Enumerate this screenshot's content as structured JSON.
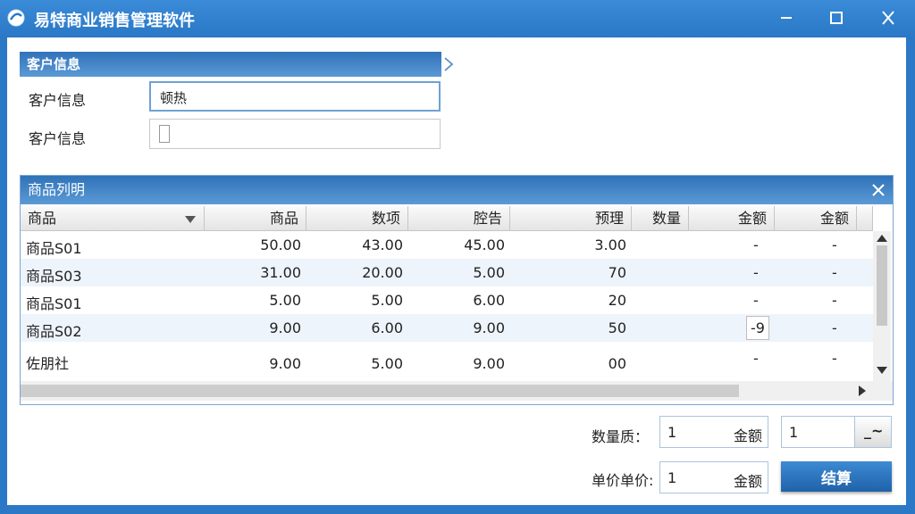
{
  "window": {
    "title": "易特商业销售管理软件",
    "icon": "app-logo-icon",
    "controls": [
      "minimize-icon",
      "maximize-icon",
      "close-icon"
    ]
  },
  "customer": {
    "header": "客户信息",
    "fields": [
      {
        "label": "客户信息",
        "value": "顿热"
      },
      {
        "label": "客户信息",
        "value": ""
      }
    ]
  },
  "products": {
    "header": "商品列明",
    "columns": [
      "商品",
      "商品",
      "数项",
      "腔告",
      "预理",
      "数量",
      "金额",
      "金额"
    ],
    "rows": [
      [
        "商品S01",
        "50.00",
        "43.00",
        "45.00",
        "3.00",
        "",
        "-",
        "-"
      ],
      [
        "商品S03",
        "31.00",
        "20.00",
        "5.00",
        "70",
        "",
        "-",
        "-"
      ],
      [
        "商品S01",
        "5.00",
        "5.00",
        "6.00",
        "20",
        "",
        "-",
        "-"
      ],
      [
        "商品S02",
        "9.00",
        "6.00",
        "9.00",
        "50",
        "",
        "-9",
        "-"
      ],
      [
        "佐朋社",
        "9.00",
        "5.00",
        "9.00",
        "00",
        "",
        "-",
        "-"
      ]
    ]
  },
  "form": {
    "qty_label": "数量质：",
    "qty_value": "1",
    "qty_suffix": "金额",
    "price_label": "单价单价:",
    "price_value": "1",
    "price_suffix": "金额",
    "select_value": "1",
    "select_btn": "_~",
    "settle_label": "结算"
  },
  "colors": {
    "accent": "#2a78c6",
    "header_blue": "#2f72b8"
  }
}
